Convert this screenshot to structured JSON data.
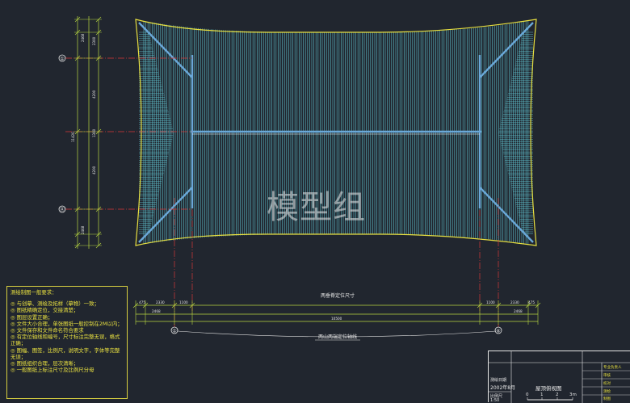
{
  "drawing": {
    "watermark": "模型组",
    "axis_left_top": "①",
    "axis_left_bottom": "Ⓐ",
    "axis_bottom_left": "①",
    "axis_bottom_right": "⑥",
    "dim_title_upper": "两垂脊定位尺寸",
    "dim_title_lower": "两山两端定位轴线",
    "dims_row1": [
      "475",
      "2330",
      "1100",
      "1100",
      "2330",
      "475"
    ],
    "dims_row2": [
      "2468",
      "2468"
    ],
    "dims_row3": [
      "10500"
    ],
    "vertical_dims": [
      "2468",
      "2300",
      "4200",
      "1300",
      "4200",
      "2468"
    ],
    "vertical_total": "11420"
  },
  "notes": {
    "title": "测绘制图一般要求：",
    "lines": [
      "◎  与创摹、测绘及拓样（摹物）一致；",
      "◎  图纸精确定位，交接清楚；",
      "◎  图层设置正确；",
      "◎  文件大小合理，单张图纸一般控制在2M以内；",
      "◎  文件保存和文件命名符合要求",
      "◎  有定位轴线和编号，尺寸标注完整无误，格式正确；",
      "◎  图幅、图签，比例尺，说明文字，字体等完整无误；",
      "◎  图纸组织合理，层次清晰；",
      "◎  一般图纸上标注尺寸及比例尺分母"
    ]
  },
  "title_block": {
    "drawing_name": "屋顶俯视图",
    "date_label": "测绘日期",
    "date": "2002年8月",
    "scale_label": "比例尺",
    "scale": "1:50",
    "scale_marks": [
      "0",
      "1",
      "2",
      "3m"
    ],
    "rows": [
      "专业负责人",
      "审核",
      "校对",
      "测绘",
      "制图"
    ]
  },
  "colors": {
    "background": "#21262f",
    "roof_tiles": "#5fc0cc",
    "outline": "#e8e040",
    "axis": "#d83838",
    "dimension": "#b8d840",
    "ridge": "#6aa8d8"
  }
}
